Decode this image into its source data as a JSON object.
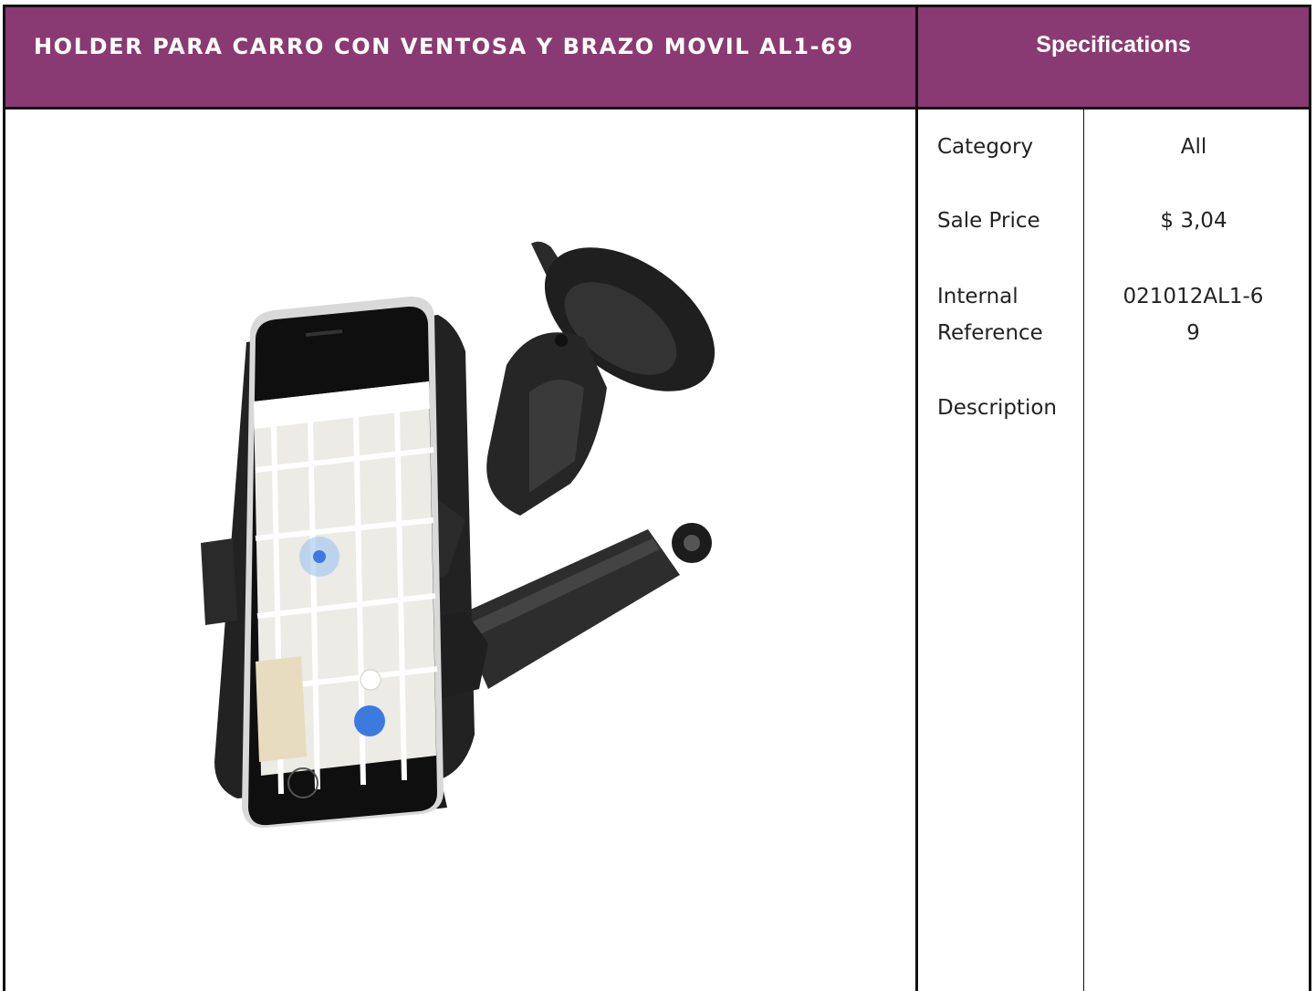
{
  "product": {
    "title": "HOLDER PARA CARRO CON VENTOSA Y BRAZO MOVIL AL1-69",
    "image_alt": "car-phone-holder-photo"
  },
  "specs": {
    "heading": "Specifications",
    "rows": [
      {
        "label": "Category",
        "value": "All"
      },
      {
        "label": "Sale Price",
        "value": "$ 3,04"
      },
      {
        "label": "Internal Reference",
        "value": "021012AL1-69"
      },
      {
        "label": "Description",
        "value": ""
      }
    ]
  },
  "colors": {
    "header_bg": "#8a3a72",
    "header_text": "#ffffff",
    "border": "#111111"
  }
}
